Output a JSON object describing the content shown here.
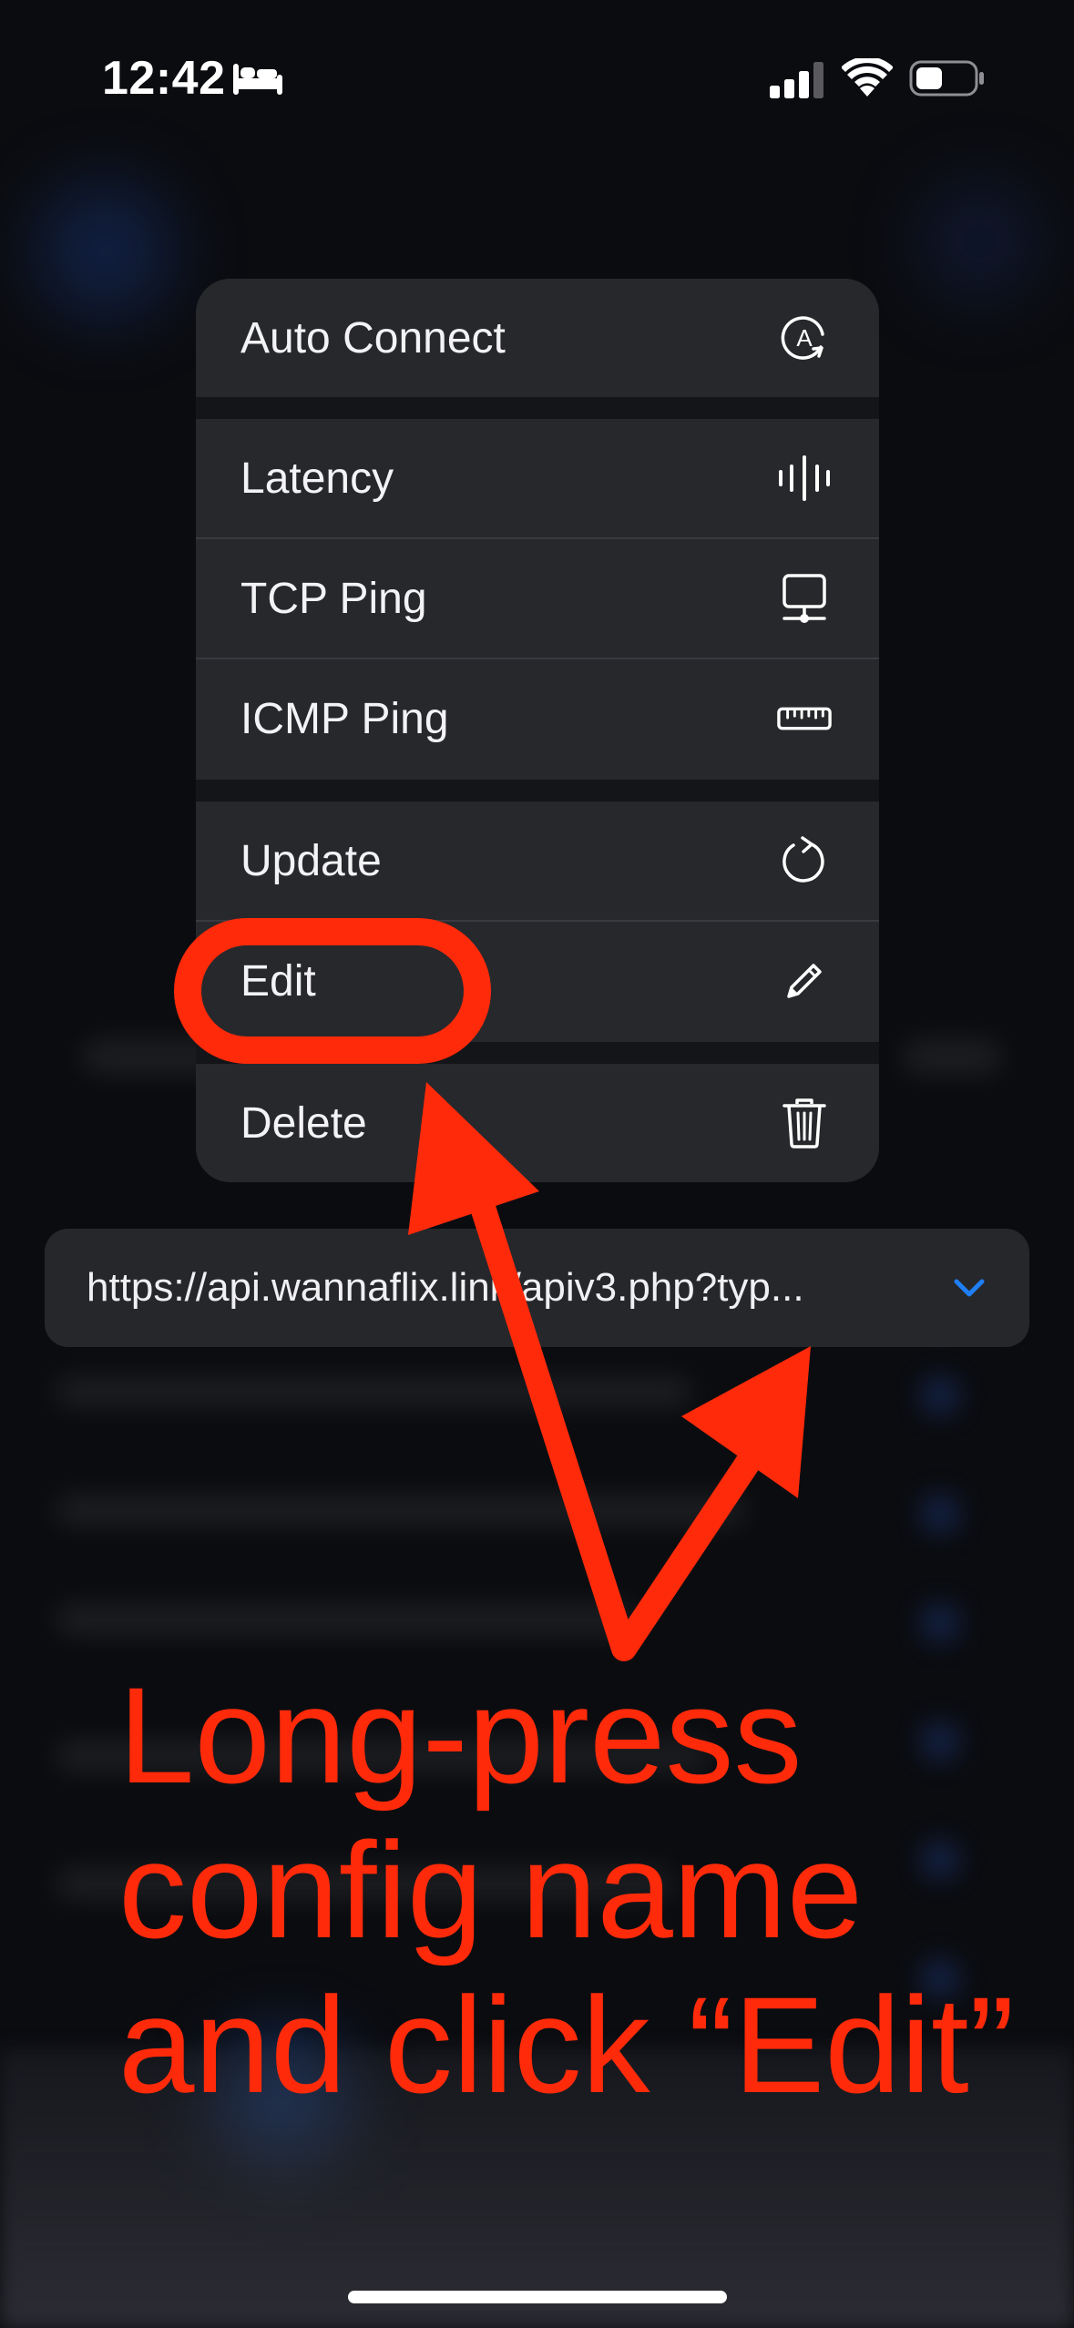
{
  "status_bar": {
    "time": "12:42"
  },
  "menu": {
    "items": [
      {
        "label": "Auto Connect",
        "icon": "auto-connect-icon"
      },
      {
        "label": "Latency",
        "icon": "waveform-icon"
      },
      {
        "label": "TCP Ping",
        "icon": "network-icon"
      },
      {
        "label": "ICMP Ping",
        "icon": "ruler-icon"
      },
      {
        "label": "Update",
        "icon": "refresh-icon"
      },
      {
        "label": "Edit",
        "icon": "pencil-icon"
      },
      {
        "label": "Delete",
        "icon": "trash-icon"
      }
    ]
  },
  "config": {
    "url": "https://api.wannaflix.link/apiv3.php?typ..."
  },
  "annotation": {
    "lines": [
      "Long-press",
      "config name",
      "and click “Edit”"
    ],
    "color": "#ff2a0a"
  },
  "colors": {
    "accent": "#1f7ff5",
    "menu_bg": "#27282c"
  }
}
